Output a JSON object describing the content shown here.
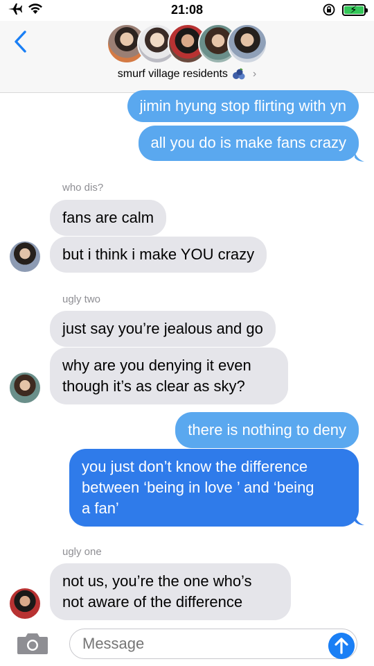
{
  "status": {
    "time": "21:08",
    "airplane_icon": "airplane-icon",
    "wifi_icon": "wifi-icon",
    "battery_level": 1.0,
    "colors": {
      "battery": "#35c759"
    }
  },
  "header": {
    "group_name": "smurf village residents",
    "emoji": "blueberries",
    "chevron": "›"
  },
  "messages": [
    {
      "side": "out",
      "text": "jimin hyung stop flirting with yn"
    },
    {
      "side": "out",
      "text": "all you do is make fans crazy"
    },
    {
      "sender": "who dis?"
    },
    {
      "side": "in",
      "text": "fans are calm"
    },
    {
      "side": "in",
      "text": "but i think i make YOU crazy"
    },
    {
      "sender": "ugly two"
    },
    {
      "side": "in",
      "text": "just say you’re jealous and go"
    },
    {
      "side": "in",
      "text_lines": [
        "why are you denying it even",
        "though it’s as clear as sky?"
      ]
    },
    {
      "side": "out",
      "text": "there is nothing to deny"
    },
    {
      "side": "out",
      "text_lines": [
        "you just don’t know the difference",
        "between ‘being in love ’ and ‘being",
        "a fan’"
      ]
    },
    {
      "sender": "ugly one"
    },
    {
      "side": "in",
      "text_lines": [
        "not us, you’re the one who’s",
        "not aware of the difference"
      ]
    }
  ],
  "composer": {
    "placeholder": "Message",
    "camera_icon": "camera-icon",
    "send_icon": "arrow-up-icon"
  },
  "colors": {
    "outgoing": "#5aa8ef",
    "outgoing_dark": "#2f7bea",
    "incoming": "#e5e5ea",
    "accent": "#1a7ff5"
  }
}
